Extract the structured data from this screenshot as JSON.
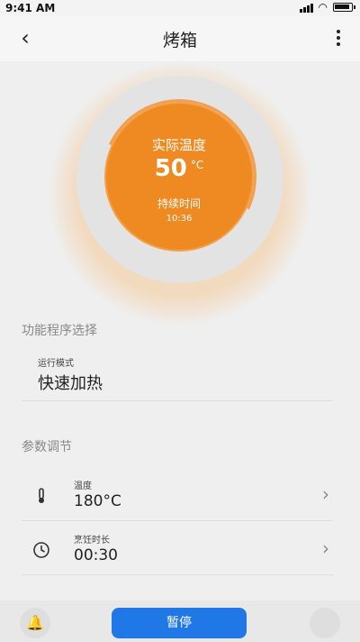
{
  "status_bar": {
    "time": "9:41 AM"
  },
  "app_bar": {
    "title": "烤箱"
  },
  "gauge": {
    "actual_label": "实际温度",
    "temperature": "50",
    "unit": "°C",
    "duration_label": "持续时间",
    "duration_value": "10:36"
  },
  "program_section": {
    "title": "功能程序选择",
    "mode_label": "运行模式",
    "mode_value": "快速加热"
  },
  "params_section": {
    "title": "参数调节",
    "items": [
      {
        "label": "温度",
        "value": "180°C",
        "icon": "thermometer-icon"
      },
      {
        "label": "烹饪时长",
        "value": "00:30",
        "icon": "clock-icon"
      }
    ]
  },
  "bottom_bar": {
    "pause_label": "暂停"
  },
  "colors": {
    "accent_orange": "#ef8a22",
    "primary_blue": "#1f78e6"
  }
}
